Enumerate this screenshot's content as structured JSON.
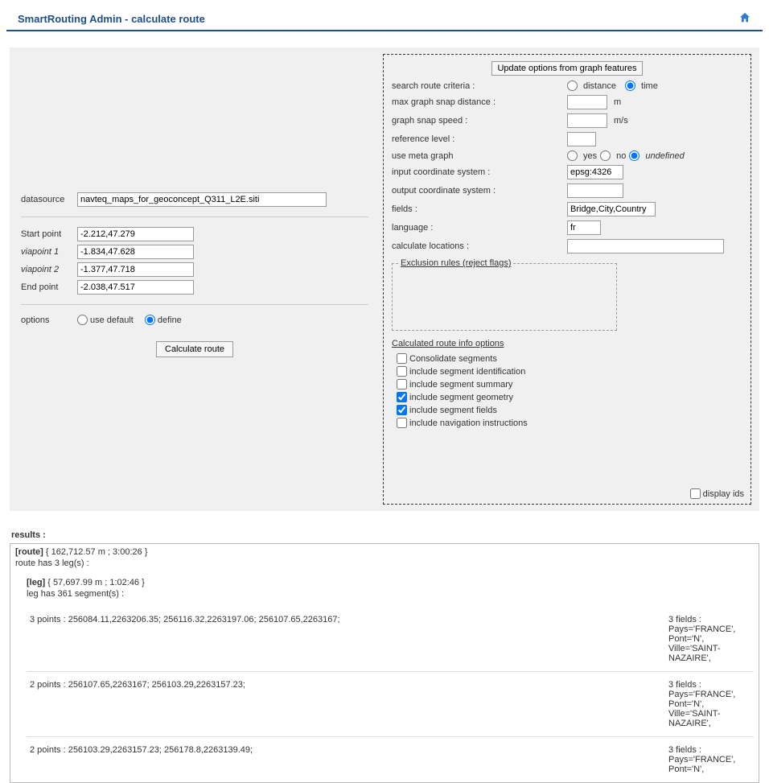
{
  "header": {
    "title": "SmartRouting Admin - calculate route"
  },
  "left": {
    "datasource_label": "datasource",
    "datasource": "navteq_maps_for_geoconcept_Q311_L2E.siti",
    "start_label": "Start point",
    "start": "-2.212,47.279",
    "via1_label": "viapoint 1",
    "via1": "-1.834,47.628",
    "via2_label": "viapoint 2",
    "via2": "-1.377,47.718",
    "end_label": "End point",
    "end": "-2.038,47.517",
    "options_label": "options",
    "use_default_label": "use default",
    "define_label": "define",
    "calculate_btn": "Calculate route"
  },
  "right": {
    "update_btn": "Update options from graph features",
    "search_criteria_label": "search route criteria :",
    "distance_label": "distance",
    "time_label": "time",
    "max_snap_label": "max graph snap distance :",
    "max_snap_value": "",
    "max_snap_unit": "m",
    "snap_speed_label": "graph snap speed :",
    "snap_speed_value": "",
    "snap_speed_unit": "m/s",
    "ref_level_label": "reference level :",
    "ref_level_value": "",
    "use_meta_label": "use meta graph",
    "yes_label": "yes",
    "no_label": "no",
    "undefined_label": "undefined",
    "input_cs_label": "input coordinate system :",
    "input_cs_value": "epsg:4326",
    "output_cs_label": "output coordinate system :",
    "output_cs_value": "",
    "fields_label": "fields :",
    "fields_value": "Bridge,City,Country",
    "language_label": "language :",
    "language_value": "fr",
    "calc_loc_label": "calculate locations :",
    "calc_loc_value": "",
    "exclusion_legend": "Exclusion rules (reject flags)",
    "calc_info_header": "Calculated route info options",
    "chk_consolidate": "Consolidate segments",
    "chk_ident": "include segment identification",
    "chk_summary": "include segment summary",
    "chk_geom": "include segment geometry",
    "chk_fields": "include segment fields",
    "chk_nav": "include navigation instructions",
    "display_ids_label": "display ids"
  },
  "results": {
    "label": "results :",
    "route_tag": "[route]",
    "route_summary": "{ 162,712.57 m ; 3:00:26 }",
    "route_legs": "route has 3 leg(s) :",
    "leg_tag": "[leg]",
    "leg_summary": "{ 57,697.99 m ; 1:02:46 }",
    "leg_segments": "leg has 361 segment(s) :",
    "rows": [
      {
        "points": "3 points : 256084.11,2263206.35; 256116.32,2263197.06; 256107.65,2263167;",
        "fields": "3 fields : Pays='FRANCE', Pont='N', Ville='SAINT-NAZAIRE',"
      },
      {
        "points": "2 points : 256107.65,2263167; 256103.29,2263157.23;",
        "fields": "3 fields : Pays='FRANCE', Pont='N', Ville='SAINT-NAZAIRE',"
      },
      {
        "points": "2 points : 256103.29,2263157.23; 256178.8,2263139.49;",
        "fields": "3 fields : Pays='FRANCE', Pont='N',"
      }
    ]
  }
}
